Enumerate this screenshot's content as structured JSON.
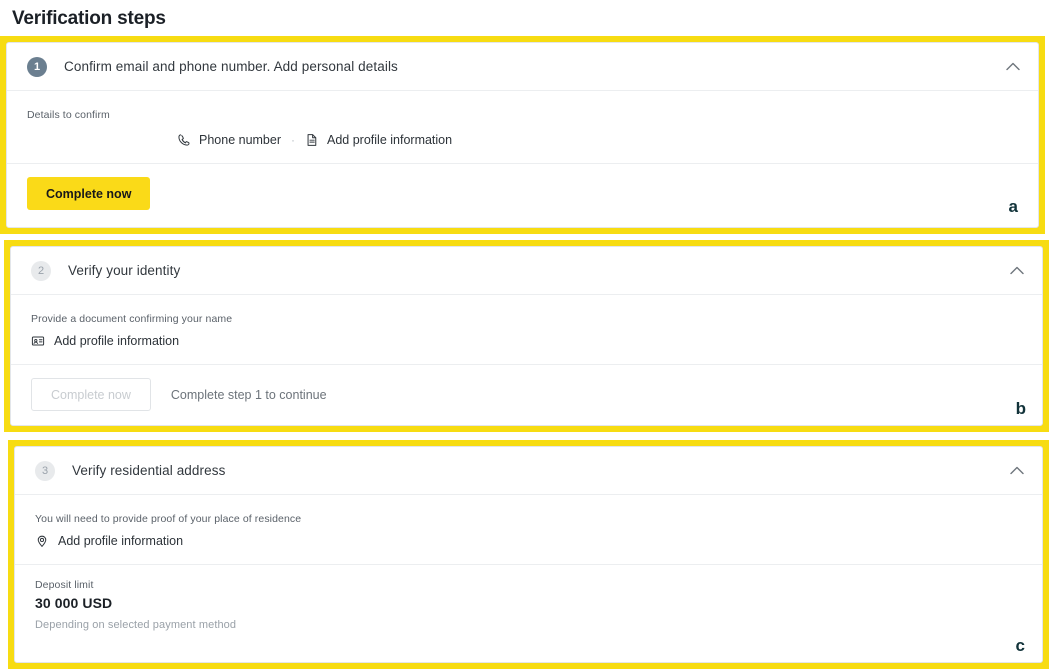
{
  "page": {
    "title": "Verification steps"
  },
  "colors": {
    "highlight": "#f7dc12",
    "primary_button": "#fada18",
    "badge_active": "#6b7f90",
    "badge_pending": "#e8eaec",
    "annotation": "#12333a"
  },
  "steps": [
    {
      "number": "1",
      "state": "active",
      "title": "Confirm email and phone number. Add personal details",
      "collapse_icon": "chevron-up-icon",
      "body_label": "Details to confirm",
      "chips": [
        {
          "icon": "phone-icon",
          "label": "Phone number"
        },
        {
          "icon": "document-icon",
          "label": "Add profile information"
        }
      ],
      "chip_separator": "·",
      "primary_button": "Complete now",
      "annotation": "a"
    },
    {
      "number": "2",
      "state": "pending",
      "title": "Verify your identity",
      "collapse_icon": "chevron-up-icon",
      "body_label": "Provide a document confirming your name",
      "item": {
        "icon": "id-card-icon",
        "label": "Add profile information"
      },
      "disabled_button": "Complete now",
      "footer_hint": "Complete step 1 to continue",
      "annotation": "b"
    },
    {
      "number": "3",
      "state": "pending",
      "title": "Verify residential address",
      "collapse_icon": "chevron-up-icon",
      "body_label": "You will need to provide proof of your place of residence",
      "item": {
        "icon": "location-pin-icon",
        "label": "Add profile information"
      },
      "deposit": {
        "label": "Deposit limit",
        "value": "30 000 USD",
        "note": "Depending on selected payment method"
      },
      "annotation": "c"
    }
  ]
}
